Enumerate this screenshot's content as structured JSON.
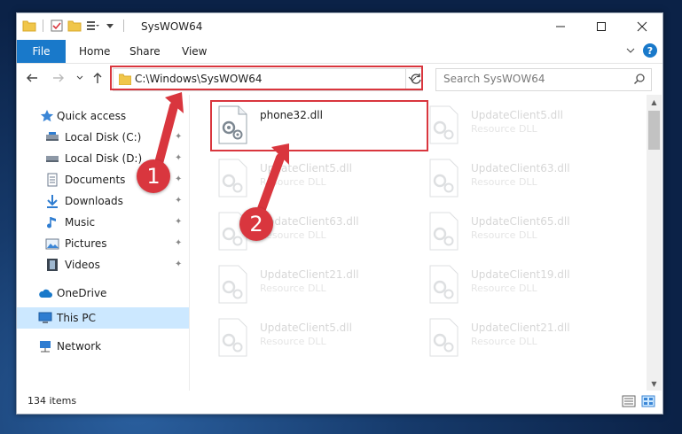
{
  "window": {
    "title": "SysWOW64"
  },
  "ribbon": {
    "tabs": [
      "File",
      "Home",
      "Share",
      "View"
    ],
    "help_label": "?"
  },
  "address": {
    "path": "C:\\Windows\\SysWOW64"
  },
  "search": {
    "placeholder": "Search SysWOW64"
  },
  "nav": {
    "items": [
      {
        "label": "Quick access",
        "icon": "star-icon"
      },
      {
        "label": "Local Disk (C:)",
        "icon": "drive-icon",
        "pinned": true
      },
      {
        "label": "Local Disk (D:)",
        "icon": "drive-icon",
        "pinned": true
      },
      {
        "label": "Documents",
        "icon": "documents-icon",
        "pinned": true
      },
      {
        "label": "Downloads",
        "icon": "download-icon",
        "pinned": true
      },
      {
        "label": "Music",
        "icon": "music-icon",
        "pinned": true
      },
      {
        "label": "Pictures",
        "icon": "pictures-icon",
        "pinned": true
      },
      {
        "label": "Videos",
        "icon": "videos-icon",
        "pinned": true
      },
      {
        "label": "OneDrive",
        "icon": "cloud-icon"
      },
      {
        "label": "This PC",
        "icon": "computer-icon",
        "selected": true
      },
      {
        "label": "Network",
        "icon": "network-icon"
      }
    ]
  },
  "files": [
    {
      "name": "phone32.dll",
      "type": ""
    },
    {
      "name": "UpdateClient5.dll",
      "type": "Resource DLL"
    },
    {
      "name": "UpdateClient5.dll",
      "type": "Resource DLL"
    },
    {
      "name": "UpdateClient63.dll",
      "type": "Resource DLL"
    },
    {
      "name": "UpdateClient63.dll",
      "type": "Resource DLL"
    },
    {
      "name": "UpdateClient65.dll",
      "type": "Resource DLL"
    },
    {
      "name": "UpdateClient21.dll",
      "type": "Resource DLL"
    },
    {
      "name": "UpdateClient19.dll",
      "type": "Resource DLL"
    },
    {
      "name": "UpdateClient5.dll",
      "type": "Resource DLL"
    },
    {
      "name": "UpdateClient21.dll",
      "type": "Resource DLL"
    }
  ],
  "status": {
    "count": "134 items"
  },
  "annotations": {
    "step1": "1",
    "step2": "2"
  },
  "colors": {
    "accent": "#1979ca",
    "highlight": "#d9363e",
    "selection": "#cce8ff"
  }
}
